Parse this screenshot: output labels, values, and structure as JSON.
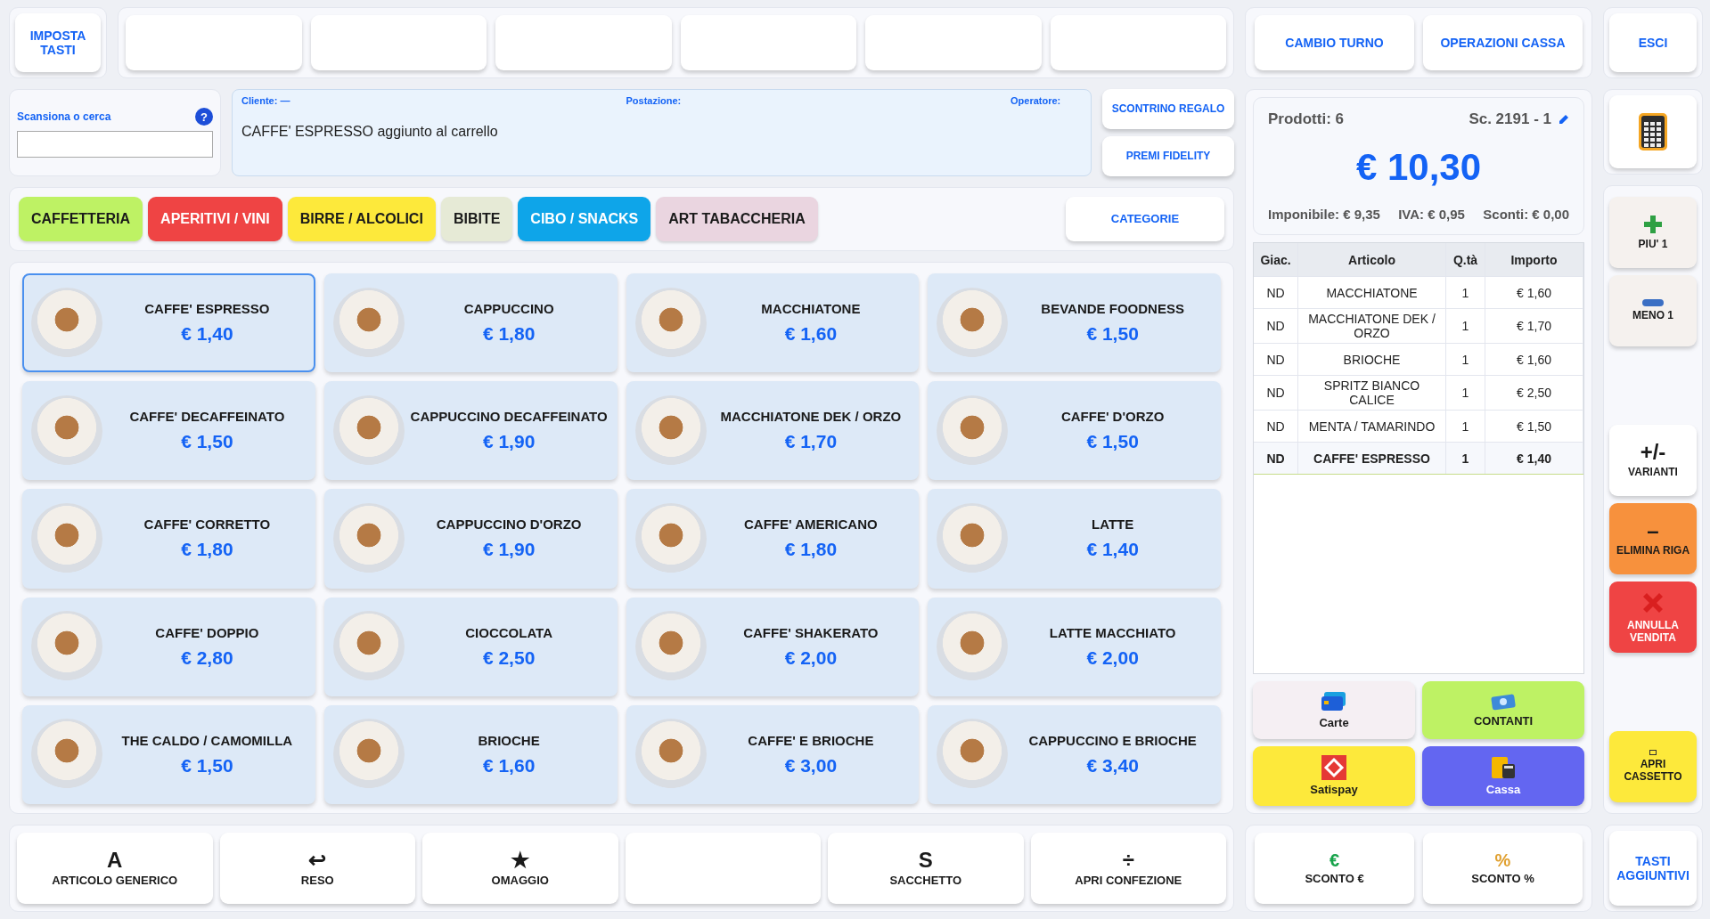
{
  "top_bar": {
    "setup_button": "IMPOSTA TASTI",
    "keys": [
      {
        "kind": "empty"
      },
      {
        "kind": "empty"
      },
      {
        "kind": "empty"
      },
      {
        "kind": "empty"
      },
      {
        "kind": "empty"
      },
      {
        "kind": "empty"
      }
    ],
    "shift_button": "CAMBIO TURNO",
    "register_button": "OPERAZIONI CASSA",
    "exit_button": "ESCI"
  },
  "search": {
    "label": "Scansiona o cerca",
    "help": "?"
  },
  "info": {
    "customer": "Cliente: —",
    "station": "Postazione:",
    "operator": "Operatore:",
    "message": "CAFFE' ESPRESSO aggiunto al carrello"
  },
  "side_actions": [
    "SCONTRINO REGALO",
    "PREMI FIDELITY"
  ],
  "categories": [
    {
      "label": "CAFFETTERIA",
      "color": "#bef264"
    },
    {
      "label": "APERITIVI / VINI",
      "color": "#ef4444"
    },
    {
      "label": "BIRRE / ALCOLICI",
      "color": "#fde93b"
    },
    {
      "label": "BIBITE",
      "color": "#e6ead6"
    },
    {
      "label": "CIBO / SNACKS",
      "color": "#0ea5e9"
    },
    {
      "label": "ART TABACCHERIA",
      "color": "#ead5e0"
    }
  ],
  "categories_button": "CATEGORIE",
  "products": [
    {
      "name": "CAFFE' ESPRESSO",
      "price": "€ 1,40",
      "selected": true
    },
    {
      "name": "CAPPUCCINO",
      "price": "€ 1,80",
      "selected": false
    },
    {
      "name": "MACCHIATONE",
      "price": "€ 1,60",
      "selected": false
    },
    {
      "name": "BEVANDE FOODNESS",
      "price": "€ 1,50",
      "selected": false
    },
    {
      "name": "CAFFE' DECAFFEINATO",
      "price": "€ 1,50",
      "selected": false
    },
    {
      "name": "CAPPUCCINO DECAFFEINATO",
      "price": "€ 1,90",
      "selected": false
    },
    {
      "name": "MACCHIATONE DEK / ORZO",
      "price": "€ 1,70",
      "selected": false
    },
    {
      "name": "CAFFE' D'ORZO",
      "price": "€ 1,50",
      "selected": false
    },
    {
      "name": "CAFFE' CORRETTO",
      "price": "€ 1,80",
      "selected": false
    },
    {
      "name": "CAPPUCCINO D'ORZO",
      "price": "€ 1,90",
      "selected": false
    },
    {
      "name": "CAFFE' AMERICANO",
      "price": "€ 1,80",
      "selected": false
    },
    {
      "name": "LATTE",
      "price": "€ 1,40",
      "selected": false
    },
    {
      "name": "CAFFE' DOPPIO",
      "price": "€ 2,80",
      "selected": false
    },
    {
      "name": "CIOCCOLATA",
      "price": "€ 2,50",
      "selected": false
    },
    {
      "name": "CAFFE' SHAKERATO",
      "price": "€ 2,00",
      "selected": false
    },
    {
      "name": "LATTE MACCHIATO",
      "price": "€ 2,00",
      "selected": false
    },
    {
      "name": "THE CALDO / CAMOMILLA",
      "price": "€ 1,50",
      "selected": false
    },
    {
      "name": "BRIOCHE",
      "price": "€ 1,60",
      "selected": false
    },
    {
      "name": "CAFFE' E BRIOCHE",
      "price": "€ 3,00",
      "selected": false
    },
    {
      "name": "CAPPUCCINO E BRIOCHE",
      "price": "€ 3,40",
      "selected": false
    }
  ],
  "quick_keys": [
    {
      "kind": "key",
      "glyph": "A",
      "label": "ARTICOLO GENERICO"
    },
    {
      "kind": "key",
      "glyph": "↩",
      "label": "RESO"
    },
    {
      "kind": "key",
      "glyph": "★",
      "label": "OMAGGIO"
    },
    {
      "kind": "empty"
    },
    {
      "kind": "key",
      "glyph": "S",
      "label": "SACCHETTO"
    },
    {
      "kind": "key",
      "glyph": "÷",
      "label": "APRI CONFEZIONE"
    }
  ],
  "summary": {
    "products": "Prodotti: 6",
    "receipt": "Sc. 2191 - 1",
    "total": "€ 10,30",
    "taxable": "Imponibile: € 9,35",
    "vat": "IVA: € 0,95",
    "discounts": "Sconti: € 0,00"
  },
  "cart": {
    "columns": [
      "Giac.",
      "Articolo",
      "Q.tà",
      "Importo"
    ],
    "rows": [
      {
        "stock": "ND",
        "item": "MACCHIATONE",
        "qty": "1",
        "amount": "€ 1,60",
        "selected": false
      },
      {
        "stock": "ND",
        "item": "MACCHIATONE DEK / ORZO",
        "qty": "1",
        "amount": "€ 1,70",
        "selected": false
      },
      {
        "stock": "ND",
        "item": "BRIOCHE",
        "qty": "1",
        "amount": "€ 1,60",
        "selected": false
      },
      {
        "stock": "ND",
        "item": "SPRITZ BIANCO CALICE",
        "qty": "1",
        "amount": "€ 2,50",
        "selected": false
      },
      {
        "stock": "ND",
        "item": "MENTA / TAMARINDO",
        "qty": "1",
        "amount": "€ 1,50",
        "selected": false
      },
      {
        "stock": "ND",
        "item": "CAFFE' ESPRESSO",
        "qty": "1",
        "amount": "€ 1,40",
        "selected": true
      }
    ]
  },
  "payments": [
    {
      "kind": "card",
      "label": "Carte",
      "color": "#f5eff3"
    },
    {
      "kind": "cash",
      "label": "CONTANTI",
      "color": "#bef264"
    },
    {
      "kind": "satispay",
      "label": "Satispay",
      "color": "#fde93b"
    },
    {
      "kind": "register",
      "label": "Cassa",
      "color": "#6366f1"
    }
  ],
  "discounts": [
    {
      "symbol": "€",
      "label": "SCONTO €",
      "color": "#16a34a"
    },
    {
      "symbol": "%",
      "label": "SCONTO %",
      "color": "#e0a030"
    }
  ],
  "right_tools": [
    {
      "kind": "plus",
      "label": "PIU' 1",
      "color": "#f5f1ee"
    },
    {
      "kind": "minus",
      "label": "MENO 1",
      "color": "#f5f1ee"
    },
    {
      "kind": "spacer"
    },
    {
      "kind": "glyph",
      "glyph": "+/-",
      "label": "VARIANTI",
      "color": "#ffffff"
    },
    {
      "kind": "glyph",
      "glyph": "–",
      "label": "ELIMINA RIGA",
      "color": "#f7913d"
    },
    {
      "kind": "cross",
      "label": "ANNULLA VENDITA",
      "color": "#ef4444"
    },
    {
      "kind": "spacer"
    },
    {
      "kind": "drawer",
      "label": "APRI CASSETTO",
      "color": "#fde93b"
    }
  ],
  "more_keys": "TASTI AGGIUNTIVI"
}
